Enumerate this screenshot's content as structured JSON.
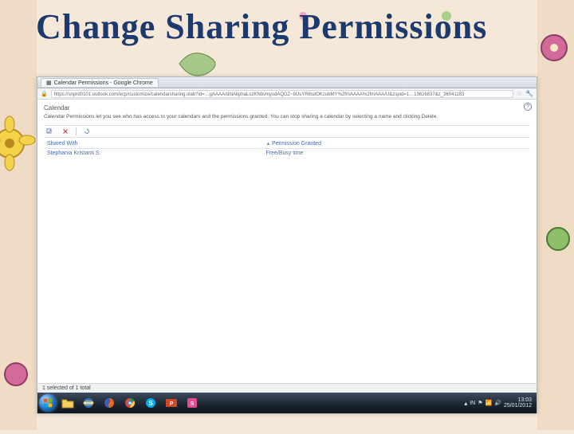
{
  "slide": {
    "title": "Change Sharing Permissions"
  },
  "browser": {
    "tab_title": "Calendar Permissions - Google Chrome",
    "lock": "🔒",
    "url": "https://snprd0101.outlook.com/ecp/customize/calendarsharing.slab?id=…gAAAA/d/dAkphaLszKNbvmysdAQDZ~bUsYR8sdOKzubMY%2fmAAAA%2fmAAA/U&zspid=1…13626837&z_36041183"
  },
  "page": {
    "heading": "Calendar",
    "description": "Calendar Permissions let you see who has access to your calendars and the permissions granted. You can stop sharing a calendar by selecting a name and clicking Delete."
  },
  "toolbar": {
    "delete_label": "",
    "refresh_label": ""
  },
  "table": {
    "col_shared": "Shared With",
    "col_perm": "Permission Granted",
    "rows": [
      {
        "name": "Stephania Kristanti S.",
        "perm": "Free/Busy time"
      }
    ]
  },
  "status": {
    "selection": "1 selected of 1 total"
  },
  "taskbar": {
    "lang": "IN",
    "time": "13:03",
    "date": "25/01/2012"
  }
}
